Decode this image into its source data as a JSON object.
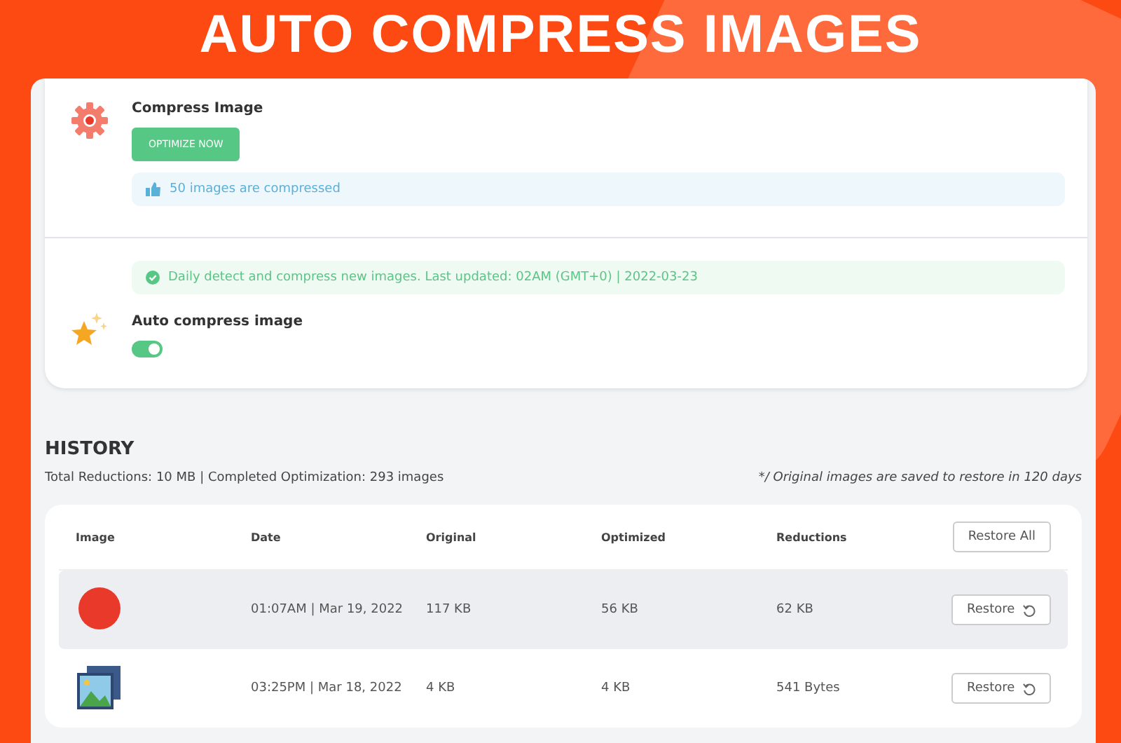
{
  "banner": {
    "title": "AUTO COMPRESS IMAGES"
  },
  "compress": {
    "label": "Compress Image",
    "button": "OPTIMIZE NOW",
    "notice": "50 images are compressed"
  },
  "auto": {
    "notice": "Daily detect and compress new images. Last updated: 02AM (GMT+0) | 2022-03-23",
    "label": "Auto compress image",
    "on": true
  },
  "history": {
    "title": "HISTORY",
    "summary": "Total Reductions: 10 MB | Completed Optimization: 293 images",
    "note": "*/ Original images are saved to restore in 120 days",
    "columns": [
      "Image",
      "Date",
      "Original",
      "Optimized",
      "Reductions"
    ],
    "restore_all": "Restore All",
    "rows": [
      {
        "kind": "blob",
        "highlighted": true,
        "date": "01:07AM | Mar 19, 2022",
        "original": "117 KB",
        "optimized": "56 KB",
        "reductions": "62 KB",
        "action": "Restore"
      },
      {
        "kind": "picture",
        "highlighted": false,
        "date": "03:25PM | Mar 18, 2022",
        "original": "4 KB",
        "optimized": "4 KB",
        "reductions": "541 Bytes",
        "action": "Restore"
      }
    ]
  }
}
